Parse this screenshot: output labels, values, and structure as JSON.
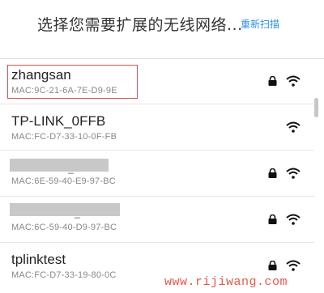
{
  "header": {
    "title": "选择您需要扩展的无线网络...",
    "rescan_label": "重新扫描"
  },
  "networks": [
    {
      "ssid": "zhangsan",
      "mac": "MAC:9C-21-6A-7E-D9-9E",
      "locked": true,
      "selected": true
    },
    {
      "ssid": "TP-LINK_0FFB",
      "mac": "MAC:FC-D7-33-10-0F-FB",
      "locked": false,
      "selected": false
    },
    {
      "ssid": "",
      "ssid_visible_fragment": "_",
      "mac": "MAC:6E-59-40-E9-97-BC",
      "locked": true,
      "selected": false
    },
    {
      "ssid": "",
      "ssid_visible_fragment": "_",
      "mac": "MAC:6C-59-40-D9-97-BC",
      "locked": true,
      "selected": false
    },
    {
      "ssid": "tplinktest",
      "mac": "MAC:FC-D7-33-19-80-0C",
      "locked": true,
      "selected": false
    }
  ],
  "icons": {
    "lock": "lock-icon",
    "wifi": "wifi-icon"
  },
  "colors": {
    "accent": "#2e8fe0",
    "selection_border": "#d9534f",
    "watermark": "#e05a4e"
  },
  "watermark": "www.rijiwang.com"
}
